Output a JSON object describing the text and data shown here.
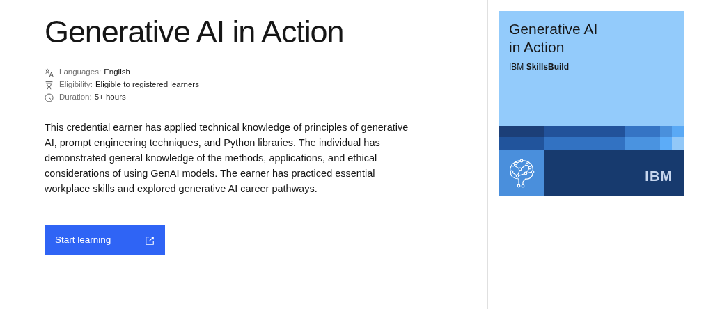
{
  "title": "Generative AI in Action",
  "meta": [
    {
      "kind": "language",
      "label": "Languages:",
      "value": "English"
    },
    {
      "kind": "eligibility",
      "label": "Eligibility:",
      "value": "Eligible to registered learners"
    },
    {
      "kind": "duration",
      "label": "Duration:",
      "value": "5+ hours"
    }
  ],
  "description": "This credential earner has applied technical knowledge of principles of generative AI, prompt engineering techniques, and Python libraries. The individual has demonstrated general knowledge of the methods, applications, and ethical considerations of using GenAI models. The earner has practiced essential workplace skills and explored generative AI career pathways.",
  "button": {
    "label": "Start learning"
  },
  "badge": {
    "title": "Generative AI in Action",
    "brand": "IBM **SkillsBuild**",
    "logo": "IBM"
  }
}
